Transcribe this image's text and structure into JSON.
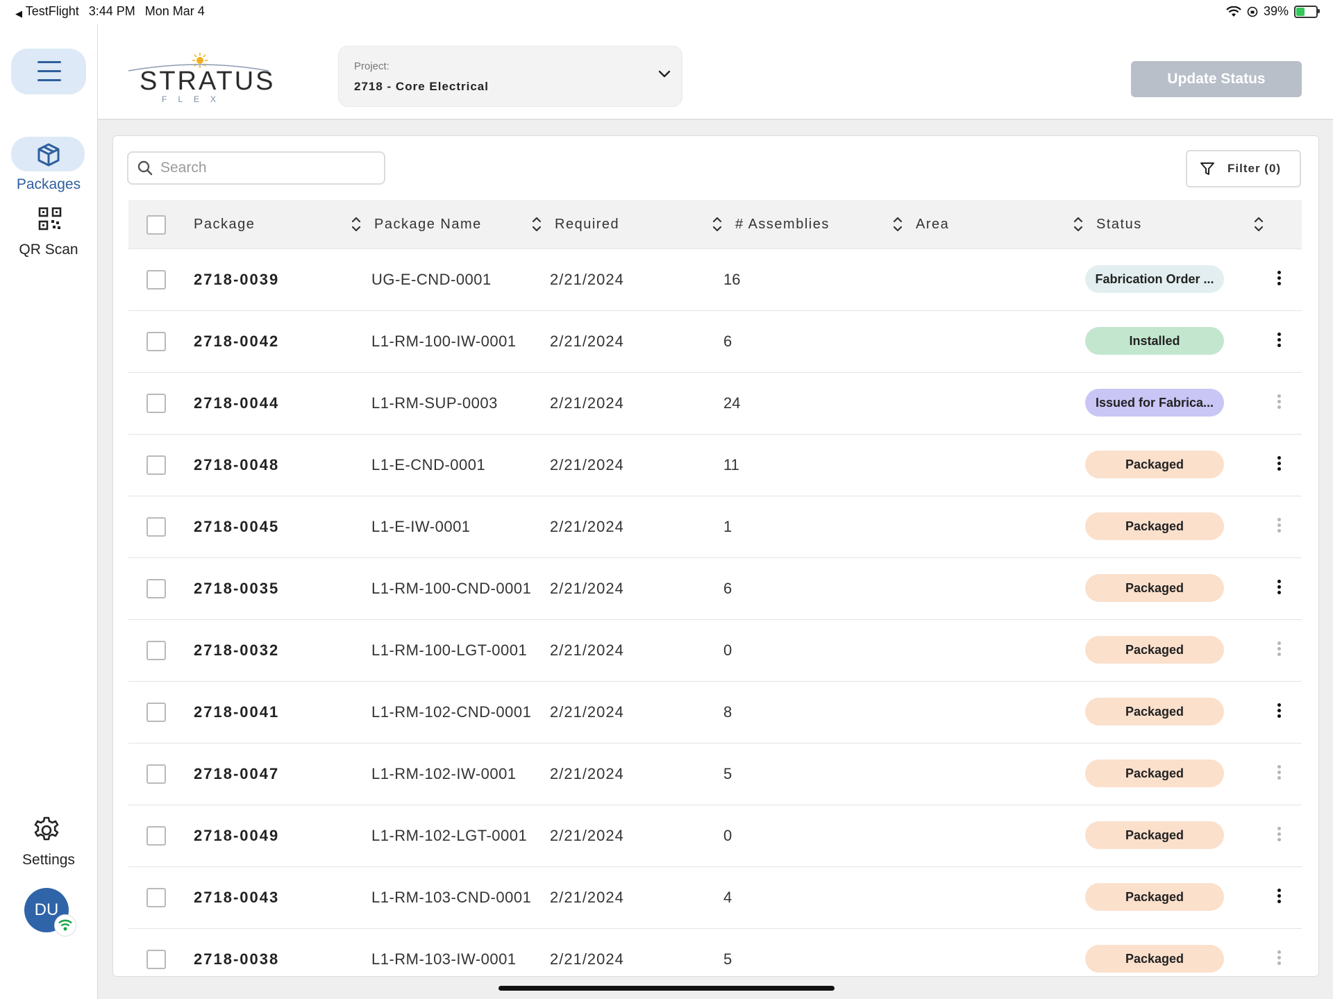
{
  "status_bar": {
    "app_back": "TestFlight",
    "time": "3:44 PM",
    "date": "Mon Mar 4",
    "battery": "39%"
  },
  "sidebar": {
    "items": [
      {
        "label": "Packages",
        "icon": "package-icon",
        "active": true
      },
      {
        "label": "QR Scan",
        "icon": "qr-scan-icon",
        "active": false
      }
    ],
    "settings_label": "Settings",
    "avatar_initials": "DU"
  },
  "header": {
    "logo_text": "STRATUS",
    "logo_sub": "FLEX",
    "project_label": "Project:",
    "project_value": "2718 - Core Electrical",
    "update_button": "Update Status"
  },
  "toolbar": {
    "search_placeholder": "Search",
    "filter_label": "Filter (0)"
  },
  "table": {
    "columns": [
      "Package",
      "Package Name",
      "Required",
      "# Assemblies",
      "Area",
      "Status"
    ],
    "rows": [
      {
        "package": "2718-0039",
        "name": "UG-E-CND-0001",
        "required": "2/21/2024",
        "assemblies": "16",
        "area": "",
        "status": "Fabrication Order ...",
        "status_color": "#e3eef0",
        "menu_active": true
      },
      {
        "package": "2718-0042",
        "name": "L1-RM-100-IW-0001",
        "required": "2/21/2024",
        "assemblies": "6",
        "area": "",
        "status": "Installed",
        "status_color": "#c3e6cf",
        "menu_active": true
      },
      {
        "package": "2718-0044",
        "name": "L1-RM-SUP-0003",
        "required": "2/21/2024",
        "assemblies": "24",
        "area": "",
        "status": "Issued for Fabrica...",
        "status_color": "#c9c5f5",
        "menu_active": false
      },
      {
        "package": "2718-0048",
        "name": "L1-E-CND-0001",
        "required": "2/21/2024",
        "assemblies": "11",
        "area": "",
        "status": "Packaged",
        "status_color": "#fbe0cc",
        "menu_active": true
      },
      {
        "package": "2718-0045",
        "name": "L1-E-IW-0001",
        "required": "2/21/2024",
        "assemblies": "1",
        "area": "",
        "status": "Packaged",
        "status_color": "#fbe0cc",
        "menu_active": false
      },
      {
        "package": "2718-0035",
        "name": "L1-RM-100-CND-0001",
        "required": "2/21/2024",
        "assemblies": "6",
        "area": "",
        "status": "Packaged",
        "status_color": "#fbe0cc",
        "menu_active": true
      },
      {
        "package": "2718-0032",
        "name": "L1-RM-100-LGT-0001",
        "required": "2/21/2024",
        "assemblies": "0",
        "area": "",
        "status": "Packaged",
        "status_color": "#fbe0cc",
        "menu_active": false
      },
      {
        "package": "2718-0041",
        "name": "L1-RM-102-CND-0001",
        "required": "2/21/2024",
        "assemblies": "8",
        "area": "",
        "status": "Packaged",
        "status_color": "#fbe0cc",
        "menu_active": true
      },
      {
        "package": "2718-0047",
        "name": "L1-RM-102-IW-0001",
        "required": "2/21/2024",
        "assemblies": "5",
        "area": "",
        "status": "Packaged",
        "status_color": "#fbe0cc",
        "menu_active": false
      },
      {
        "package": "2718-0049",
        "name": "L1-RM-102-LGT-0001",
        "required": "2/21/2024",
        "assemblies": "0",
        "area": "",
        "status": "Packaged",
        "status_color": "#fbe0cc",
        "menu_active": false
      },
      {
        "package": "2718-0043",
        "name": "L1-RM-103-CND-0001",
        "required": "2/21/2024",
        "assemblies": "4",
        "area": "",
        "status": "Packaged",
        "status_color": "#fbe0cc",
        "menu_active": true
      },
      {
        "package": "2718-0038",
        "name": "L1-RM-103-IW-0001",
        "required": "2/21/2024",
        "assemblies": "5",
        "area": "",
        "status": "Packaged",
        "status_color": "#fbe0cc",
        "menu_active": false
      }
    ]
  },
  "colors": {
    "accent": "#2f5e9e",
    "nav_active_bg": "#dde9f6",
    "update_button_disabled": "#b8bfc9"
  }
}
